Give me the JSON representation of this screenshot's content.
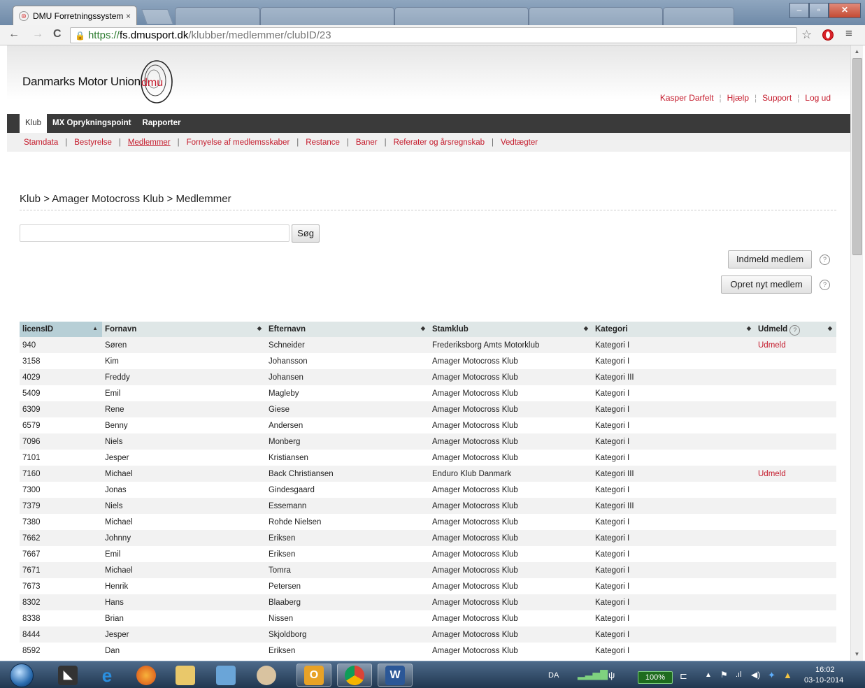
{
  "browser": {
    "tab_title": "DMU Forretningssystem",
    "tab_close": "×",
    "url_scheme": "https://",
    "url_host": "fs.dmusport.dk",
    "url_path": "/klubber/medlemmer/clubID/23",
    "nav_back": "←",
    "nav_forward": "→",
    "nav_reload": "C",
    "menu": "≡",
    "star": "☆"
  },
  "header": {
    "logo_text": "Danmarks Motor Union",
    "logo_mark": "dmu",
    "user_links": [
      "Kasper Darfelt",
      "Hjælp",
      "Support",
      "Log ud"
    ]
  },
  "mainnav": [
    "Klub",
    "MX Oprykningspoint",
    "Rapporter"
  ],
  "subnav": {
    "items": [
      "Stamdata",
      "Bestyrelse",
      "Medlemmer",
      "Fornyelse af medlemsskaber",
      "Restance",
      "Baner",
      "Referater og årsregnskab",
      "Vedtægter"
    ],
    "current": "Medlemmer"
  },
  "breadcrumb": "Klub > Amager Motocross Klub > Medlemmer",
  "search": {
    "value": "",
    "button": "Søg"
  },
  "actions": {
    "enroll": "Indmeld medlem",
    "create": "Opret nyt medlem",
    "help_glyph": "?"
  },
  "table": {
    "headers": [
      "licensID",
      "Fornavn",
      "Efternavn",
      "Stamklub",
      "Kategori",
      "Udmeld"
    ],
    "sort_asc": "▲",
    "sort_both": "◆",
    "rows": [
      [
        "940",
        "Søren",
        "Schneider",
        "Frederiksborg Amts Motorklub",
        "Kategori I",
        "Udmeld"
      ],
      [
        "3158",
        "Kim",
        "Johansson",
        "Amager Motocross Klub",
        "Kategori I",
        ""
      ],
      [
        "4029",
        "Freddy",
        "Johansen",
        "Amager Motocross Klub",
        "Kategori III",
        ""
      ],
      [
        "5409",
        "Emil",
        "Magleby",
        "Amager Motocross Klub",
        "Kategori I",
        ""
      ],
      [
        "6309",
        "Rene",
        "Giese",
        "Amager Motocross Klub",
        "Kategori I",
        ""
      ],
      [
        "6579",
        "Benny",
        "Andersen",
        "Amager Motocross Klub",
        "Kategori I",
        ""
      ],
      [
        "7096",
        "Niels",
        "Monberg",
        "Amager Motocross Klub",
        "Kategori I",
        ""
      ],
      [
        "7101",
        "Jesper",
        "Kristiansen",
        "Amager Motocross Klub",
        "Kategori I",
        ""
      ],
      [
        "7160",
        "Michael",
        "Back Christiansen",
        "Enduro Klub Danmark",
        "Kategori III",
        "Udmeld"
      ],
      [
        "7300",
        "Jonas",
        "Gindesgaard",
        "Amager Motocross Klub",
        "Kategori I",
        ""
      ],
      [
        "7379",
        "Niels",
        "Essemann",
        "Amager Motocross Klub",
        "Kategori III",
        ""
      ],
      [
        "7380",
        "Michael",
        "Rohde Nielsen",
        "Amager Motocross Klub",
        "Kategori I",
        ""
      ],
      [
        "7662",
        "Johnny",
        "Eriksen",
        "Amager Motocross Klub",
        "Kategori I",
        ""
      ],
      [
        "7667",
        "Emil",
        "Eriksen",
        "Amager Motocross Klub",
        "Kategori I",
        ""
      ],
      [
        "7671",
        "Michael",
        "Tomra",
        "Amager Motocross Klub",
        "Kategori I",
        ""
      ],
      [
        "7673",
        "Henrik",
        "Petersen",
        "Amager Motocross Klub",
        "Kategori I",
        ""
      ],
      [
        "8302",
        "Hans",
        "Blaaberg",
        "Amager Motocross Klub",
        "Kategori I",
        ""
      ],
      [
        "8338",
        "Brian",
        "Nissen",
        "Amager Motocross Klub",
        "Kategori I",
        ""
      ],
      [
        "8444",
        "Jesper",
        "Skjoldborg",
        "Amager Motocross Klub",
        "Kategori I",
        ""
      ],
      [
        "8592",
        "Dan",
        "Eriksen",
        "Amager Motocross Klub",
        "Kategori I",
        ""
      ]
    ]
  },
  "taskbar": {
    "lang": "DA",
    "battery": "100%",
    "time": "16:02",
    "date": "03-10-2014"
  }
}
